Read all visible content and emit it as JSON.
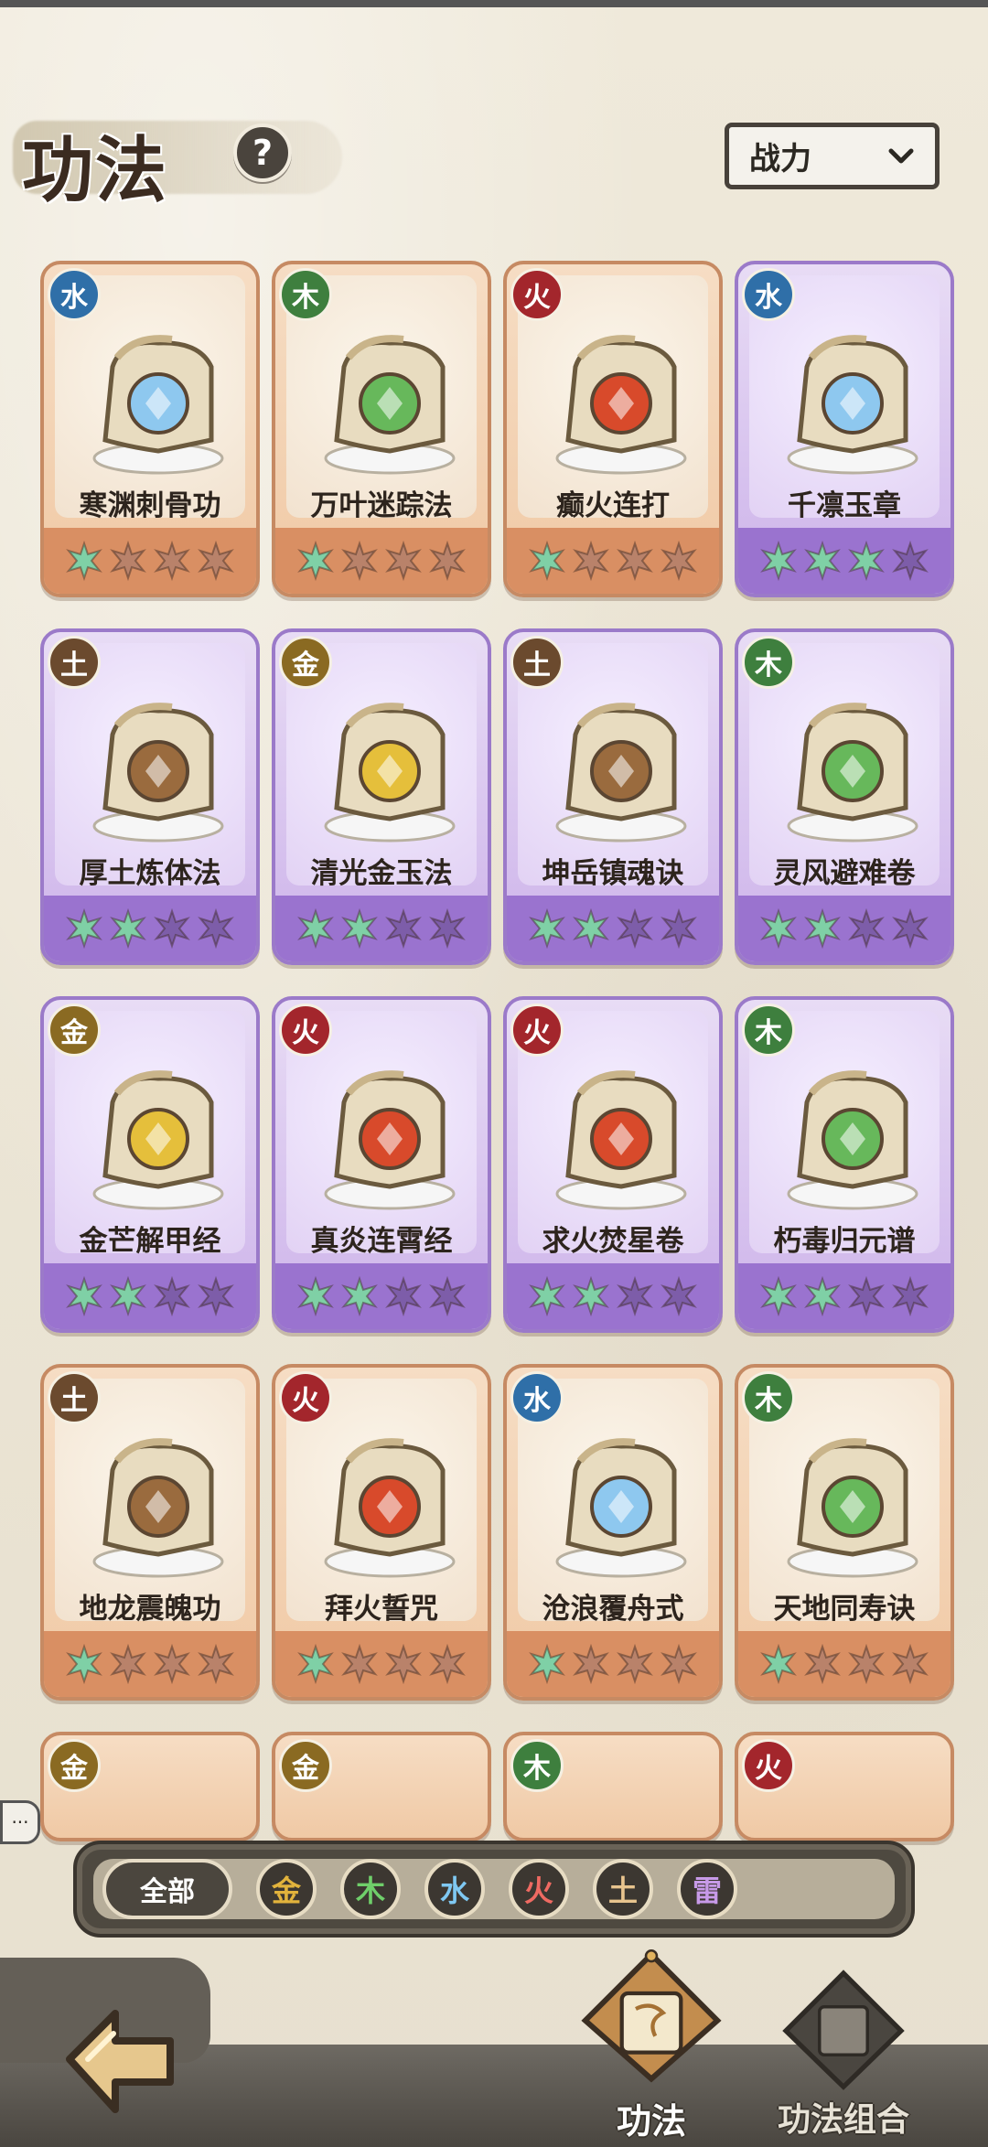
{
  "header": {
    "title": "功法",
    "help_label": "?",
    "sort": {
      "selected": "战力"
    }
  },
  "cards": [
    {
      "name": "寒渊刺骨功",
      "element": "水",
      "rarity": "orange",
      "stars_lit": 1,
      "art": "crystal-icon"
    },
    {
      "name": "万叶迷踪法",
      "element": "木",
      "rarity": "orange",
      "stars_lit": 1,
      "art": "green-leaves-icon"
    },
    {
      "name": "癫火连打",
      "element": "火",
      "rarity": "orange",
      "stars_lit": 1,
      "art": "fire-orb-icon"
    },
    {
      "name": "千凛玉章",
      "element": "水",
      "rarity": "purple",
      "stars_lit": 3,
      "art": "ice-shard-icon"
    },
    {
      "name": "厚土炼体法",
      "element": "土",
      "rarity": "purple",
      "stars_lit": 2,
      "art": "axe-icon"
    },
    {
      "name": "清光金玉法",
      "element": "金",
      "rarity": "purple",
      "stars_lit": 2,
      "art": "gold-emblem-icon"
    },
    {
      "name": "坤岳镇魂诀",
      "element": "土",
      "rarity": "purple",
      "stars_lit": 2,
      "art": "rocks-icon"
    },
    {
      "name": "灵风避难卷",
      "element": "木",
      "rarity": "purple",
      "stars_lit": 2,
      "art": "leaf-icon"
    },
    {
      "name": "金芒解甲经",
      "element": "金",
      "rarity": "purple",
      "stars_lit": 2,
      "art": "gold-sword-icon"
    },
    {
      "name": "真炎连霄经",
      "element": "火",
      "rarity": "purple",
      "stars_lit": 2,
      "art": "flame-icon"
    },
    {
      "name": "求火焚星卷",
      "element": "火",
      "rarity": "purple",
      "stars_lit": 2,
      "art": "fire-pot-icon"
    },
    {
      "name": "朽毒归元谱",
      "element": "木",
      "rarity": "purple",
      "stars_lit": 2,
      "art": "poison-skull-icon"
    },
    {
      "name": "地龙震魄功",
      "element": "土",
      "rarity": "orange",
      "stars_lit": 1,
      "art": "earth-dragon-icon"
    },
    {
      "name": "拜火誓咒",
      "element": "火",
      "rarity": "orange",
      "stars_lit": 1,
      "art": "fire-armor-icon"
    },
    {
      "name": "沧浪覆舟式",
      "element": "水",
      "rarity": "orange",
      "stars_lit": 1,
      "art": "water-wave-icon"
    },
    {
      "name": "天地同寿诀",
      "element": "木",
      "rarity": "orange",
      "stars_lit": 1,
      "art": "green-beast-icon"
    }
  ],
  "partial_cards": [
    {
      "element": "金"
    },
    {
      "element": "金"
    },
    {
      "element": "木"
    },
    {
      "element": "火"
    }
  ],
  "filters": {
    "all_label": "全部",
    "elements": [
      "金",
      "木",
      "水",
      "火",
      "土",
      "雷"
    ]
  },
  "nav": {
    "tab_gongfa": "功法",
    "tab_combo": "功法组合"
  },
  "colors": {
    "orange_card": "#f0c9a5",
    "purple_card": "#cdb3ea",
    "star_lit": "#7fd0a6",
    "star_dim_orange": "#b9826a",
    "star_dim_purple": "#7d5da9"
  }
}
